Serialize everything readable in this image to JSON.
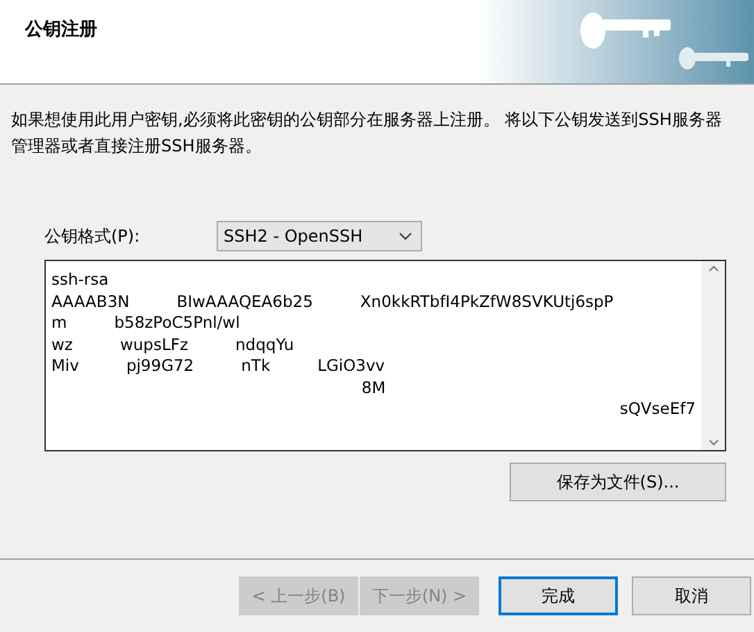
{
  "header": {
    "title": "公钥注册"
  },
  "description": "如果想使用此用户密钥,必须将此密钥的公钥部分在服务器上注册。 将以下公钥发送到SSH服务器管理器或者直接注册SSH服务器。",
  "format": {
    "label": "公钥格式(P):",
    "value": "SSH2 - OpenSSH"
  },
  "key_text": {
    "lines": [
      [
        "ssh-rsa"
      ],
      [
        "AAAAB3N",
        "BIwAAAQEA6b25",
        "Xn0kkRTbfI4PkZfW8SVKUtj6spP"
      ],
      [
        "m",
        "b58zPoC5Pnl/wl"
      ],
      [
        "wz",
        "wupsLFz",
        "ndqqYu"
      ],
      [
        "Miv",
        "pj99G72",
        "nTk",
        "LGiO3vv"
      ],
      [
        "8M"
      ],
      [
        "sQVseEf7"
      ]
    ]
  },
  "save_button": {
    "label": "保存为文件(S)..."
  },
  "buttons": [
    {
      "label": "< 上一步(B)",
      "disabled": true,
      "selected": false
    },
    {
      "label": "下一步(N) >",
      "disabled": true,
      "selected": false
    },
    {
      "label": "完成",
      "disabled": false,
      "selected": true
    },
    {
      "label": "取消",
      "disabled": false,
      "selected": false
    }
  ]
}
